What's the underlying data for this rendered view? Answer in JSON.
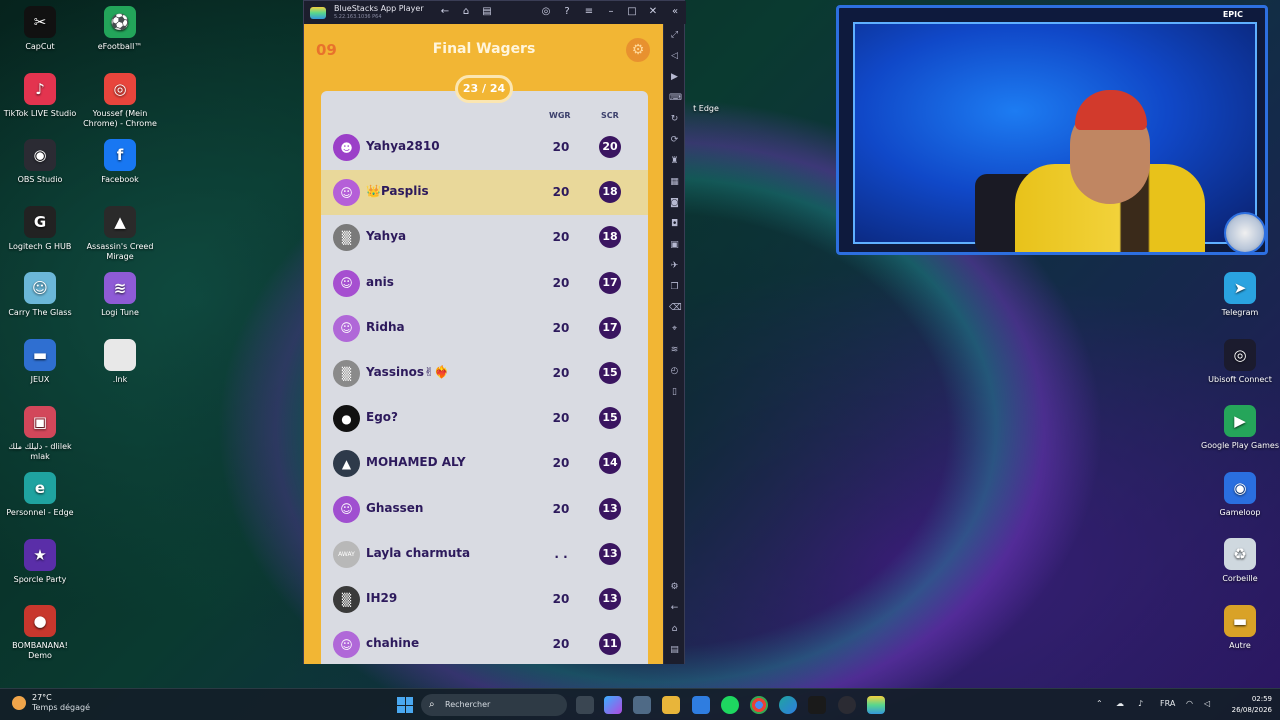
{
  "desktop": {
    "left_icons": [
      {
        "label": "CapCut",
        "color": "#111111",
        "glyph": "✂"
      },
      {
        "label": "TikTok LIVE Studio",
        "color": "#e3344f",
        "glyph": "♪"
      },
      {
        "label": "OBS Studio",
        "color": "#2b2b33",
        "glyph": "◉"
      },
      {
        "label": "Logitech G HUB",
        "color": "#222222",
        "glyph": "G"
      },
      {
        "label": "Carry The Glass",
        "color": "#6bb7d8",
        "glyph": "☺"
      },
      {
        "label": "JEUX",
        "color": "#2f6fd1",
        "glyph": "▬"
      },
      {
        "label": "دليلك ملك - dlilek mlak",
        "color": "#d2475a",
        "glyph": "▣"
      },
      {
        "label": "Personnel - Edge",
        "color": "#1fa3a0",
        "glyph": "e"
      },
      {
        "label": "Sporcle Party",
        "color": "#5a2ea8",
        "glyph": "★"
      },
      {
        "label": "BOMBANANA! Demo",
        "color": "#c8372d",
        "glyph": "●"
      }
    ],
    "right_col_icons": [
      {
        "label": "eFootball™",
        "color": "#23a55a",
        "glyph": "⚽"
      },
      {
        "label": "Youssef (Mein Chrome) - Chrome",
        "color": "#e8453c",
        "glyph": "◎"
      },
      {
        "label": "Facebook",
        "color": "#1877f2",
        "glyph": "f"
      },
      {
        "label": "Assassin's Creed Mirage",
        "color": "#2a2a2a",
        "glyph": "▲"
      },
      {
        "label": "Logi Tune",
        "color": "#8e5bd6",
        "glyph": "≋"
      },
      {
        "label": ".lnk",
        "color": "#e8e8e8",
        "glyph": ""
      }
    ],
    "far_right_icons": [
      {
        "label": "Telegram",
        "color": "#2aa3e0",
        "glyph": "➤"
      },
      {
        "label": "Ubisoft Connect",
        "color": "#1b1b2e",
        "glyph": "◎"
      },
      {
        "label": "Google Play Games",
        "color": "#25a55a",
        "glyph": "▶"
      },
      {
        "label": "Gameloop",
        "color": "#2a6fe0",
        "glyph": "◉"
      },
      {
        "label": "Corbeille",
        "color": "#cfd8df",
        "glyph": "♻"
      },
      {
        "label": "Autre",
        "color": "#d9a227",
        "glyph": "▬"
      }
    ],
    "partial_label": "t Edge"
  },
  "bluestacks": {
    "title": "BlueStacks App Player",
    "subtitle": "5.22.163.1036 P64"
  },
  "game": {
    "round": "09",
    "title": "Final Wagers",
    "counter": "23 / 24",
    "columns": {
      "wager": "WGR",
      "score": "SCR"
    },
    "players": [
      {
        "name": "Yahya2810",
        "wager": "20",
        "score": "20",
        "avatar_bg": "#9b3fc8",
        "avatar_glyph": "☻",
        "highlight": false
      },
      {
        "name": "👑Pasplis",
        "wager": "20",
        "score": "18",
        "avatar_bg": "#b55fd8",
        "avatar_glyph": "☺",
        "highlight": true
      },
      {
        "name": "Yahya",
        "wager": "20",
        "score": "18",
        "avatar_bg": "#7a7a7a",
        "avatar_glyph": "▒",
        "highlight": false
      },
      {
        "name": "anis",
        "wager": "20",
        "score": "17",
        "avatar_bg": "#a64fd0",
        "avatar_glyph": "☺",
        "highlight": false
      },
      {
        "name": "Ridha",
        "wager": "20",
        "score": "17",
        "avatar_bg": "#b068d8",
        "avatar_glyph": "☺",
        "highlight": false
      },
      {
        "name": "Yassinos✌❤‍🔥",
        "wager": "20",
        "score": "15",
        "avatar_bg": "#8a8a8a",
        "avatar_glyph": "▒",
        "highlight": false
      },
      {
        "name": "   Ego?",
        "wager": "20",
        "score": "15",
        "avatar_bg": "#111111",
        "avatar_glyph": "●",
        "highlight": false
      },
      {
        "name": "MOHAMED ALY",
        "wager": "20",
        "score": "14",
        "avatar_bg": "#2e3a4a",
        "avatar_glyph": "▲",
        "highlight": false
      },
      {
        "name": "Ghassen",
        "wager": "20",
        "score": "13",
        "avatar_bg": "#a04fd0",
        "avatar_glyph": "☺",
        "highlight": false
      },
      {
        "name": "Layla charmuta",
        "wager": ". .",
        "score": "13",
        "avatar_bg": "#b8b8b8",
        "avatar_glyph": "AWAY",
        "highlight": false
      },
      {
        "name": "IH29",
        "wager": "20",
        "score": "13",
        "avatar_bg": "#3a3a3a",
        "avatar_glyph": "▒",
        "highlight": false
      },
      {
        "name": "chahine",
        "wager": "20",
        "score": "11",
        "avatar_bg": "#b068d8",
        "avatar_glyph": "☺",
        "highlight": false
      }
    ]
  },
  "webcam": {
    "brand": "EPIC"
  },
  "taskbar": {
    "weather_temp": "27°C",
    "weather_desc": "Temps dégagé",
    "search_placeholder": "Rechercher",
    "lang": "FRA",
    "time": "02:59",
    "date": "26/08/2026"
  }
}
